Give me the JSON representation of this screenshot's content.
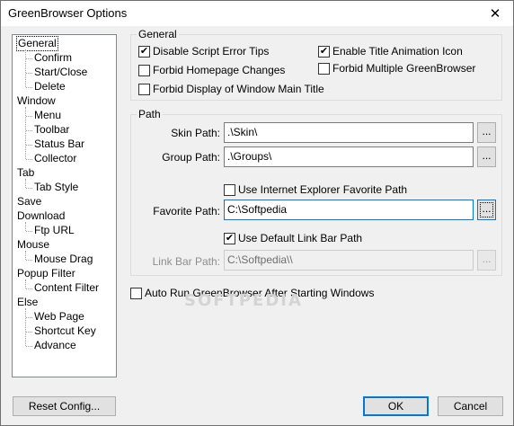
{
  "window": {
    "title": "GreenBrowser Options",
    "close_glyph": "✕"
  },
  "tree": {
    "items": [
      {
        "label": "General",
        "level": 0,
        "selected": true
      },
      {
        "label": "Confirm",
        "level": 1
      },
      {
        "label": "Start/Close",
        "level": 1
      },
      {
        "label": "Delete",
        "level": 1
      },
      {
        "label": "Window",
        "level": 0
      },
      {
        "label": "Menu",
        "level": 1
      },
      {
        "label": "Toolbar",
        "level": 1
      },
      {
        "label": "Status Bar",
        "level": 1
      },
      {
        "label": "Collector",
        "level": 1
      },
      {
        "label": "Tab",
        "level": 0
      },
      {
        "label": "Tab Style",
        "level": 1
      },
      {
        "label": "Save",
        "level": 0
      },
      {
        "label": "Download",
        "level": 0
      },
      {
        "label": "Ftp URL",
        "level": 1
      },
      {
        "label": "Mouse",
        "level": 0
      },
      {
        "label": "Mouse Drag",
        "level": 1
      },
      {
        "label": "Popup Filter",
        "level": 0
      },
      {
        "label": "Content Filter",
        "level": 1
      },
      {
        "label": "Else",
        "level": 0
      },
      {
        "label": "Web Page",
        "level": 1
      },
      {
        "label": "Shortcut Key",
        "level": 1
      },
      {
        "label": "Advance",
        "level": 1
      }
    ]
  },
  "general": {
    "label": "General",
    "disable_script_errors": {
      "label": "Disable Script Error Tips",
      "checked": true
    },
    "enable_title_animation": {
      "label": "Enable Title Animation Icon",
      "checked": true
    },
    "forbid_homepage_changes": {
      "label": "Forbid Homepage Changes",
      "checked": false
    },
    "forbid_multiple": {
      "label": "Forbid Multiple GreenBrowser",
      "checked": false
    },
    "forbid_window_title": {
      "label": "Forbid Display of Window Main Title",
      "checked": false
    }
  },
  "path": {
    "label": "Path",
    "skin": {
      "label": "Skin Path:",
      "value": ".\\Skin\\"
    },
    "group": {
      "label": "Group Path:",
      "value": ".\\Groups\\"
    },
    "use_ie_favorite": {
      "label": "Use Internet Explorer Favorite Path",
      "checked": false
    },
    "favorite": {
      "label": "Favorite Path:",
      "value": "C:\\Softpedia"
    },
    "use_default_link": {
      "label": "Use Default Link Bar Path",
      "checked": true
    },
    "link_bar": {
      "label": "Link Bar Path:",
      "value": "C:\\Softpedia\\\\"
    },
    "browse_label": "..."
  },
  "auto_run": {
    "label": "Auto Run GreenBrowser After Starting Windows",
    "checked": false
  },
  "buttons": {
    "reset": "Reset Config...",
    "ok": "OK",
    "cancel": "Cancel"
  },
  "watermark": "SOFTPEDIA"
}
